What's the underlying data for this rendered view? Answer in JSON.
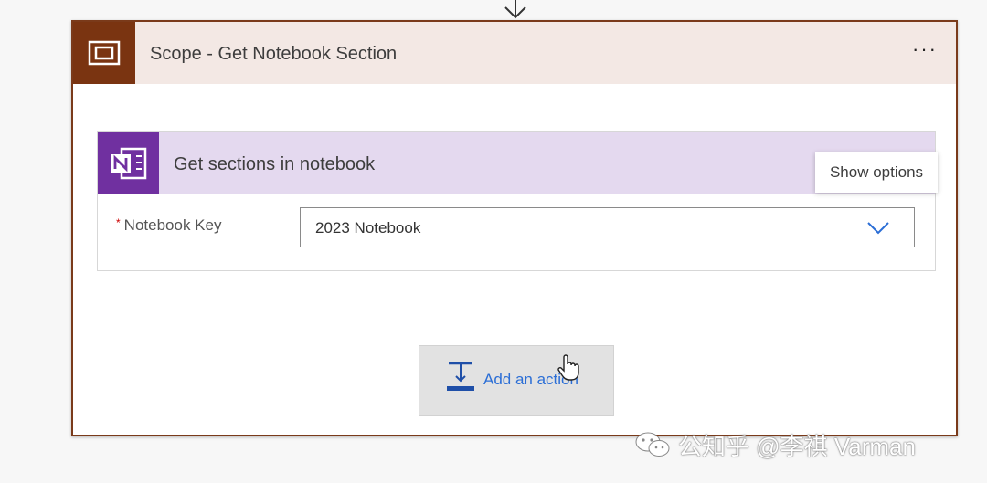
{
  "scope": {
    "title": "Scope - Get Notebook Section",
    "more_label": "···",
    "header_color": "#7a3411"
  },
  "action": {
    "title": "Get sections in notebook",
    "header_color": "#7030a0",
    "tooltip": "Show options",
    "field": {
      "label": "Notebook Key",
      "required_mark": "*",
      "value": "2023 Notebook"
    }
  },
  "add_action": {
    "label": "Add an action"
  },
  "watermark": {
    "text": "公知乎 @李祺 Varman"
  },
  "icons": [
    "down-arrow-icon",
    "scope-icon",
    "more-options-icon",
    "onenote-icon",
    "chevron-down-icon",
    "add-action-icon",
    "hand-cursor-icon",
    "wechat-icon"
  ]
}
